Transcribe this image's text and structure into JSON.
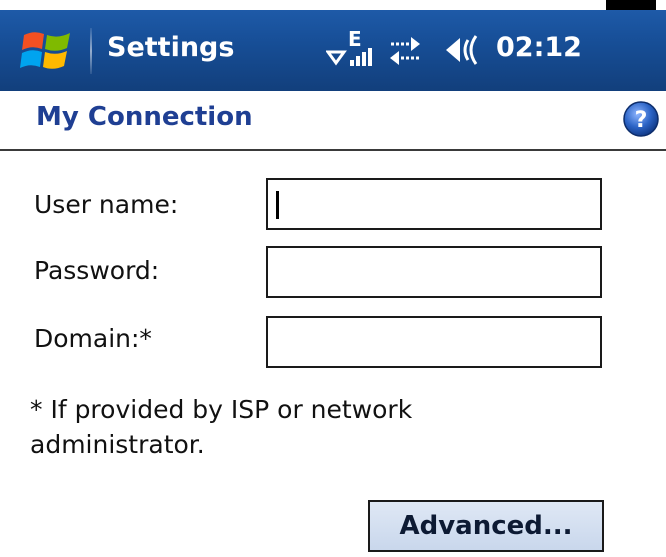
{
  "titlebar": {
    "app_title": "Settings",
    "network_label": "E",
    "clock": "02:12",
    "icons": [
      "windows-start-icon",
      "signal-icon",
      "sync-icon",
      "volume-icon"
    ]
  },
  "page": {
    "title": "My Connection",
    "help_icon_glyph": "?"
  },
  "form": {
    "username_label": "User name:",
    "username_value": "",
    "password_label": "Password:",
    "password_value": "",
    "domain_label": "Domain:*",
    "domain_value": "",
    "note": "* If provided by ISP or network administrator."
  },
  "actions": {
    "advanced_label": "Advanced..."
  },
  "colors": {
    "titlebar": "#174f98",
    "page_title": "#1f3f93",
    "help_icon": "#2c64c6"
  }
}
